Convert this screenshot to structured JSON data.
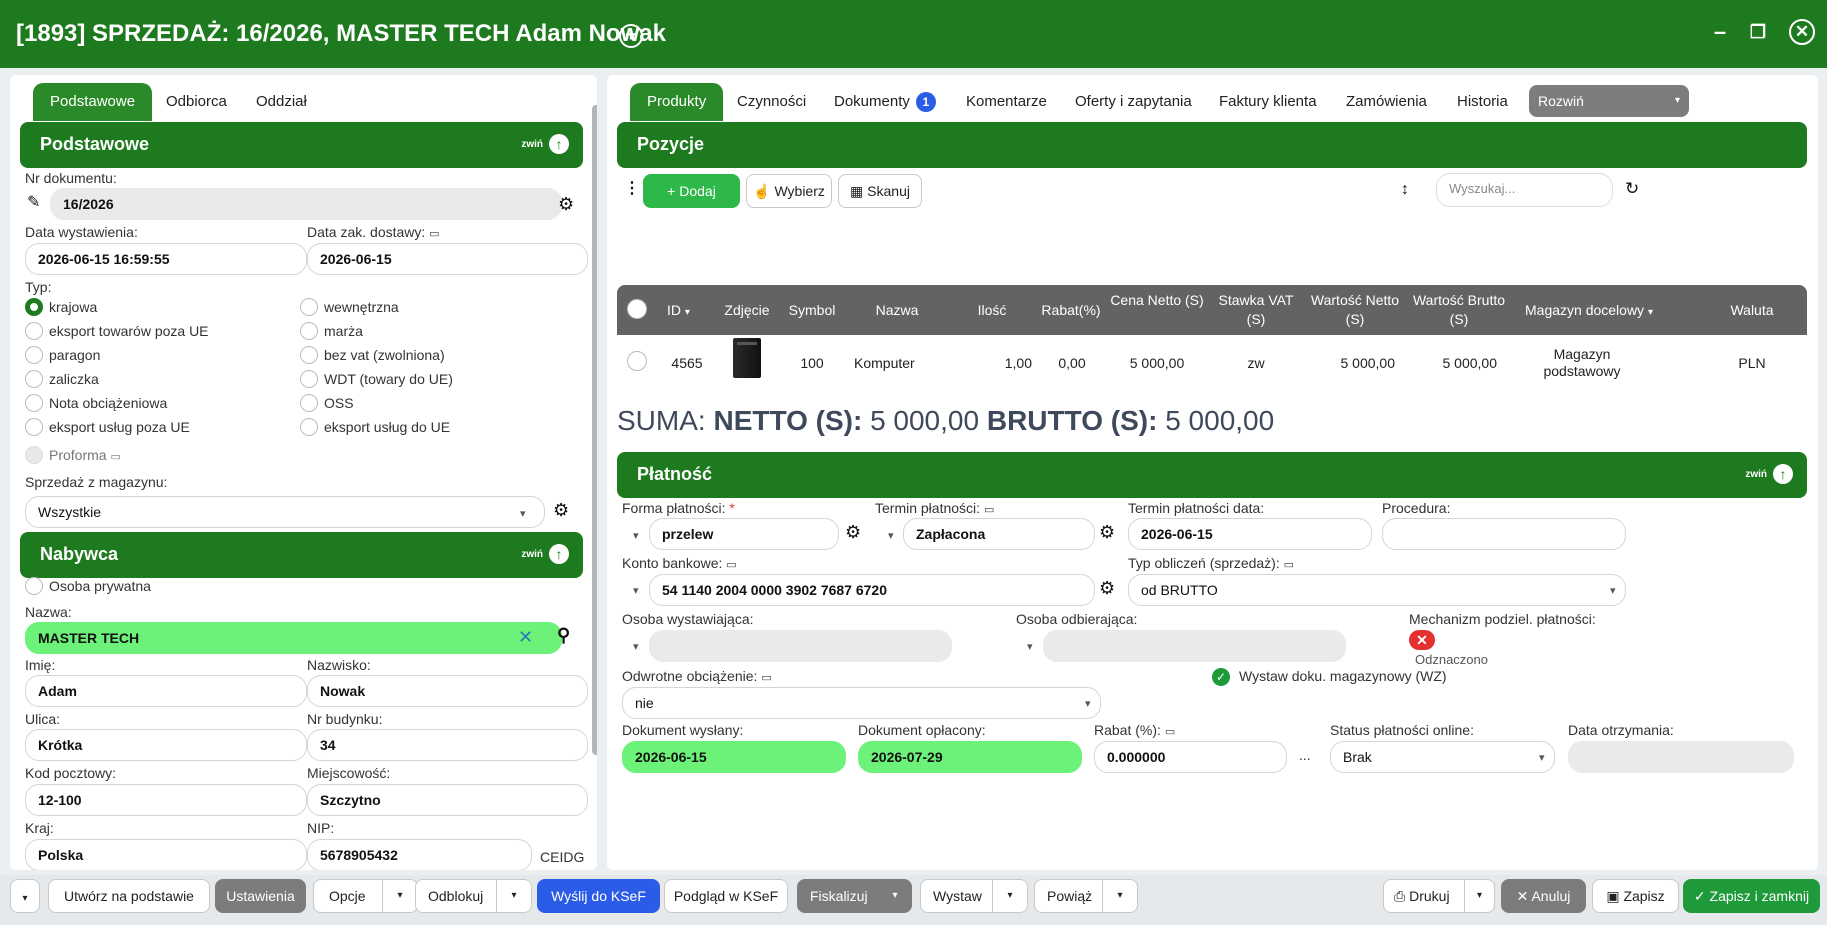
{
  "window": {
    "title": "[1893] SPRZEDAŻ: 16/2026, MASTER TECH Adam Nowak",
    "minimize": "–",
    "maximize": "❐",
    "close": "✕"
  },
  "left": {
    "tabs": [
      "Podstawowe",
      "Odbiorca",
      "Oddział"
    ],
    "section_basic": {
      "title": "Podstawowe",
      "collapse": "zwiń"
    },
    "doc_number": {
      "label": "Nr dokumentu:",
      "value": "16/2026"
    },
    "issue_date": {
      "label": "Data wystawienia:",
      "value": "2026-06-15 16:59:55"
    },
    "delivery_date": {
      "label": "Data zak. dostawy:",
      "value": "2026-06-15"
    },
    "type": {
      "label": "Typ:",
      "options_left": [
        "krajowa",
        "eksport towarów poza UE",
        "paragon",
        "zaliczka",
        "Nota obciążeniowa",
        "eksport usług poza UE"
      ],
      "options_right": [
        "wewnętrzna",
        "marża",
        "bez vat (zwolniona)",
        "WDT (towary do UE)",
        "OSS",
        "eksport usług do UE"
      ],
      "selected": "krajowa",
      "proforma": "Proforma"
    },
    "warehouse": {
      "label": "Sprzedaż z magazynu:",
      "value": "Wszystkie"
    },
    "section_buyer": {
      "title": "Nabywca",
      "collapse": "zwiń"
    },
    "private_person": "Osoba prywatna",
    "name": {
      "label": "Nazwa:",
      "value": "MASTER TECH"
    },
    "first_name": {
      "label": "Imię:",
      "value": "Adam"
    },
    "last_name": {
      "label": "Nazwisko:",
      "value": "Nowak"
    },
    "street": {
      "label": "Ulica:",
      "value": "Krótka"
    },
    "building": {
      "label": "Nr budynku:",
      "value": "34"
    },
    "postal": {
      "label": "Kod pocztowy:",
      "value": "12-100"
    },
    "city": {
      "label": "Miejscowość:",
      "value": "Szczytno"
    },
    "country": {
      "label": "Kraj:",
      "value": "Polska"
    },
    "nip": {
      "label": "NIP:",
      "value": "5678905432",
      "extra": "CEIDG"
    }
  },
  "right": {
    "tabs": [
      "Produkty",
      "Czynności",
      "Dokumenty",
      "Komentarze",
      "Oferty i zapytania",
      "Faktury klienta",
      "Zamówienia",
      "Historia"
    ],
    "documents_badge": "1",
    "expand": "Rozwiń",
    "section_positions": "Pozycje",
    "toolbar": {
      "add": "Dodaj",
      "choose": "Wybierz",
      "scan": "Skanuj",
      "search_placeholder": "Wyszukaj..."
    },
    "columns": [
      "ID",
      "Zdjęcie",
      "Symbol",
      "Nazwa",
      "Ilość",
      "Rabat(%)",
      "Cena Netto (S)",
      "Stawka VAT (S)",
      "Wartość Netto (S)",
      "Wartość Brutto (S)",
      "Magazyn docelowy",
      "Waluta"
    ],
    "rows": [
      {
        "id": "4565",
        "symbol": "100",
        "name": "Komputer",
        "qty": "1,00",
        "discount": "0,00",
        "price_net": "5 000,00",
        "vat": "zw",
        "value_net": "5 000,00",
        "value_gross": "5 000,00",
        "warehouse": "Magazyn podstawowy",
        "currency": "PLN"
      }
    ],
    "summary": {
      "prefix": "SUMA:",
      "net_label": "NETTO (S):",
      "net": "5 000,00",
      "gross_label": "BRUTTO (S):",
      "gross": "5 000,00"
    },
    "section_payment": {
      "title": "Płatność",
      "collapse": "zwiń"
    },
    "payment_form": {
      "label": "Forma płatności:",
      "value": "przelew"
    },
    "payment_term": {
      "label": "Termin płatności:",
      "value": "Zapłacona"
    },
    "payment_term_date": {
      "label": "Termin płatności data:",
      "value": "2026-06-15"
    },
    "procedure": {
      "label": "Procedura:",
      "value": ""
    },
    "bank_account": {
      "label": "Konto bankowe:",
      "value": "54 1140 2004 0000 3902 7687 6720"
    },
    "calc_type": {
      "label": "Typ obliczeń (sprzedaż):",
      "value": "od BRUTTO"
    },
    "issuer": {
      "label": "Osoba wystawiająca:",
      "value": ""
    },
    "receiver": {
      "label": "Osoba odbierająca:",
      "value": ""
    },
    "split_payment": {
      "label": "Mechanizm podziel. płatności:",
      "value": "Odznaczono"
    },
    "reverse_charge": {
      "label": "Odwrotne obciążenie:",
      "value": "nie"
    },
    "warehouse_doc": "Wystaw doku. magazynowy (WZ)",
    "doc_sent": {
      "label": "Dokument wysłany:",
      "value": "2026-06-15"
    },
    "doc_paid": {
      "label": "Dokument opłacony:",
      "value": "2026-07-29"
    },
    "discount": {
      "label": "Rabat (%):",
      "value": "0.000000"
    },
    "online_status": {
      "label": "Status płatności online:",
      "value": "Brak"
    },
    "receipt_date": {
      "label": "Data otrzymania:",
      "value": ""
    }
  },
  "bottom": {
    "create_from": "Utwórz na podstawie",
    "settings": "Ustawienia",
    "options": "Opcje",
    "unlock": "Odblokuj",
    "send_ksef": "Wyślij do KSeF",
    "preview_ksef": "Podgląd w KSeF",
    "fiscalize": "Fiskalizuj",
    "issue": "Wystaw",
    "link": "Powiąż",
    "print": "Drukuj",
    "cancel": "Anuluj",
    "save": "Zapisz",
    "save_close": "Zapisz i zamknij"
  }
}
